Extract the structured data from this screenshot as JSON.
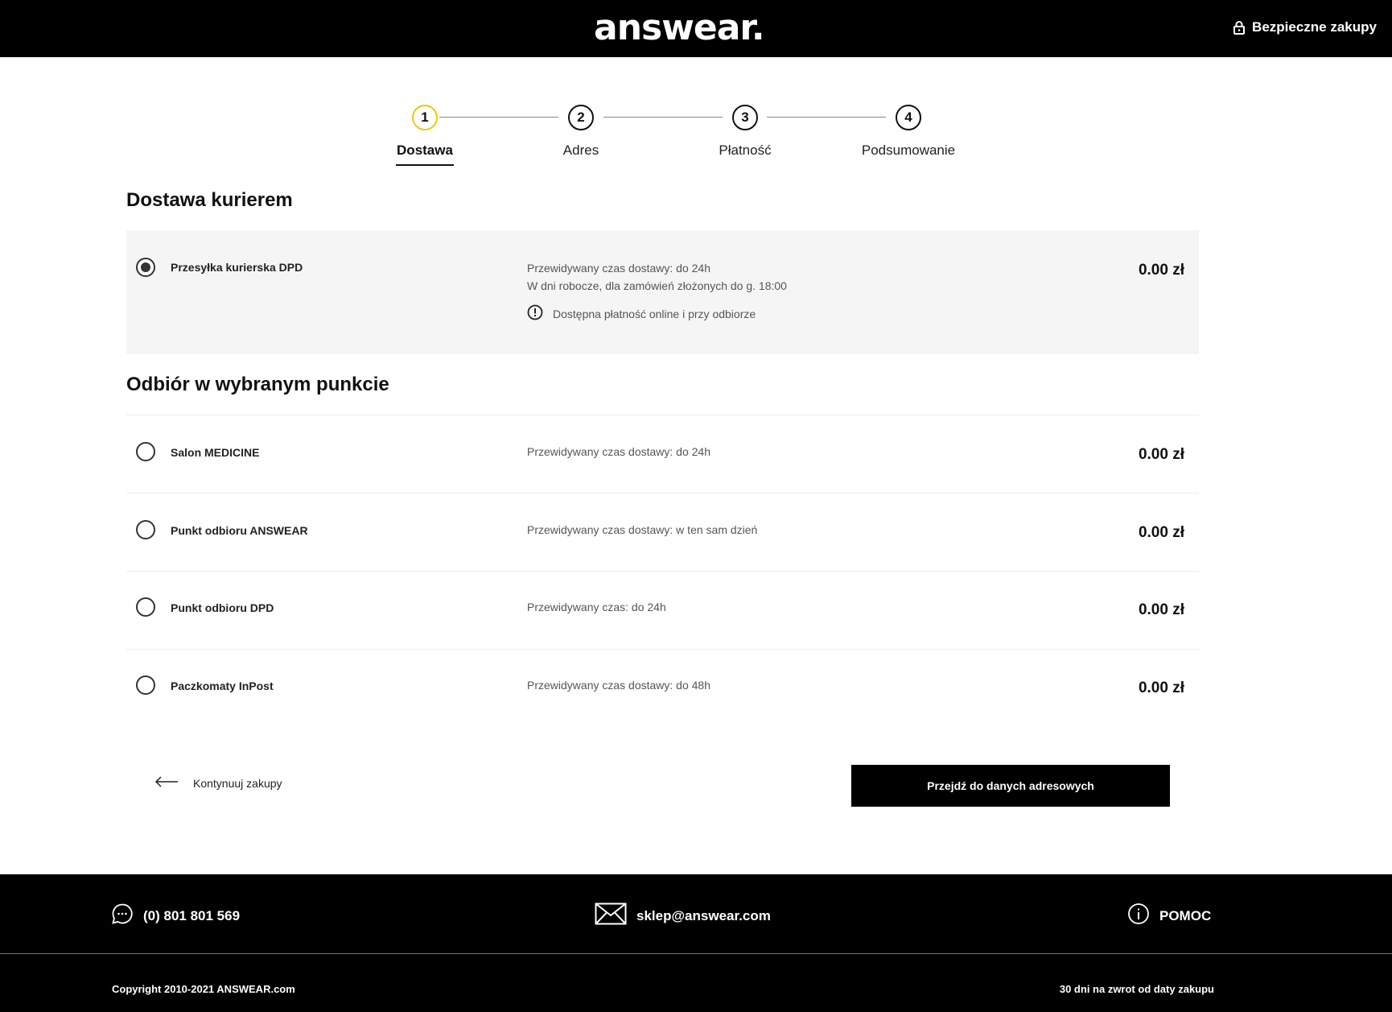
{
  "header": {
    "logo": "answear.",
    "secure_label": "Bezpieczne zakupy"
  },
  "steps": [
    {
      "number": "1",
      "label": "Dostawa",
      "active": true
    },
    {
      "number": "2",
      "label": "Adres",
      "active": false
    },
    {
      "number": "3",
      "label": "Płatność",
      "active": false
    },
    {
      "number": "4",
      "label": "Podsumowanie",
      "active": false
    }
  ],
  "courier": {
    "title": "Dostawa kurierem",
    "option": {
      "name": "Przesyłka kurierska DPD",
      "desc_line1": "Przewidywany czas dostawy: do 24h",
      "desc_line2": "W dni robocze, dla zamówień złożonych do g. 18:00",
      "note": "Dostępna płatność online i przy odbiorze",
      "price": "0.00 zł",
      "selected": true
    }
  },
  "pickup": {
    "title": "Odbiór w wybranym punkcie",
    "options": [
      {
        "name": "Salon MEDICINE",
        "desc": "Przewidywany czas dostawy: do 24h",
        "price": "0.00 zł"
      },
      {
        "name": "Punkt odbioru ANSWEAR",
        "desc": "Przewidywany czas dostawy: w ten sam dzień",
        "price": "0.00 zł"
      },
      {
        "name": "Punkt odbioru DPD",
        "desc": "Przewidywany czas: do 24h",
        "price": "0.00 zł"
      },
      {
        "name": "Paczkomaty InPost",
        "desc": "Przewidywany czas dostawy: do 48h",
        "price": "0.00 zł"
      }
    ]
  },
  "actions": {
    "continue_label": "Kontynuuj zakupy",
    "next_label": "Przejdź do danych adresowych"
  },
  "footer": {
    "phone": "(0) 801 801 569",
    "email": "sklep@answear.com",
    "help": "POMOC",
    "copyright": "Copyright 2010-2021 ANSWEAR.com",
    "returns": "30 dni na zwrot od daty zakupu"
  },
  "icons": {
    "secure": "lock-icon",
    "note": "alert-circle-icon",
    "continue": "arrow-left-icon",
    "phone": "chat-bubble-icon",
    "email": "envelope-icon",
    "help": "info-icon"
  },
  "colors": {
    "header_bg": "#000000",
    "active_step": "#f2c70f",
    "selected_bg": "#f5f5f5",
    "button_bg": "#000000"
  }
}
